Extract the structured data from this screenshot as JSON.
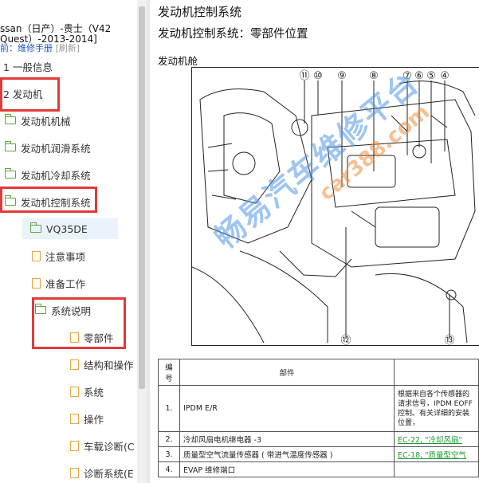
{
  "nav_header": {
    "model_line1": "ssan（日产）-贵士（V42",
    "model_line2": "Quest）-2013-2014]",
    "breadcrumb_prefix": "前：",
    "breadcrumb_link": "维修手册",
    "refresh": "[刷新]"
  },
  "tree": [
    {
      "label": "1 一般信息",
      "icon": "none",
      "selected": false
    },
    {
      "label": "2 发动机",
      "icon": "none",
      "selected": false
    },
    {
      "label": "发动机机械",
      "icon": "folder-icon",
      "selected": false
    },
    {
      "label": "发动机润滑系统",
      "icon": "folder-icon",
      "selected": false
    },
    {
      "label": "发动机冷却系统",
      "icon": "folder-icon",
      "selected": false
    },
    {
      "label": "发动机控制系统",
      "icon": "folder-icon",
      "selected": false
    },
    {
      "label": "VQ35DE",
      "icon": "folder-icon",
      "selected": true
    },
    {
      "label": "注意事项",
      "icon": "document-icon",
      "selected": false
    },
    {
      "label": "准备工作",
      "icon": "document-icon",
      "selected": false
    },
    {
      "label": "系统说明",
      "icon": "folder-icon",
      "selected": false
    },
    {
      "label": "零部件",
      "icon": "document-icon",
      "selected": false
    },
    {
      "label": "结构和操作",
      "icon": "document-icon",
      "selected": false
    },
    {
      "label": "系统",
      "icon": "document-icon",
      "selected": false
    },
    {
      "label": "操作",
      "icon": "document-icon",
      "selected": false
    },
    {
      "label": "车载诊断(C",
      "icon": "document-icon",
      "selected": false
    },
    {
      "label": "诊断系统(E",
      "icon": "document-icon",
      "selected": false
    }
  ],
  "content": {
    "title": "发动机控制系统",
    "subtitle": "发动机控制系统：零部件位置",
    "section": "发动机舱",
    "callouts": [
      "⑪",
      "⑩",
      "⑨",
      "⑧",
      "⑦",
      "⑥",
      "⑤",
      "④",
      "⑫",
      "⑬"
    ],
    "watermark": "畅易汽车维修平台",
    "watermark_site": "car388.com",
    "table": {
      "headers": [
        "编号",
        "部件",
        ""
      ],
      "rows": [
        {
          "no": "1.",
          "part": "IPDM E/R",
          "desc": "根据来自各个传感器的请求信号，IPDM EOFF 控制。有关详细的安装位置，",
          "ref": ""
        },
        {
          "no": "2.",
          "part": "冷却风扇电机继电器 -3",
          "desc": "",
          "ref": "EC-22, \"冷却风扇\""
        },
        {
          "no": "3.",
          "part": "质量型空气流量传感器 ( 带进气温度传感器 )",
          "desc": "",
          "ref": "EC-18, \"质量型空气"
        },
        {
          "no": "4.",
          "part": "EVAP 维修端口",
          "desc": "",
          "ref": ""
        }
      ]
    }
  },
  "colors": {
    "highlight_box": "#e03a3a",
    "folder": "#5aa63c",
    "document": "#e0a84a",
    "link": "#1a55c8",
    "xref": "#1f9a36"
  }
}
